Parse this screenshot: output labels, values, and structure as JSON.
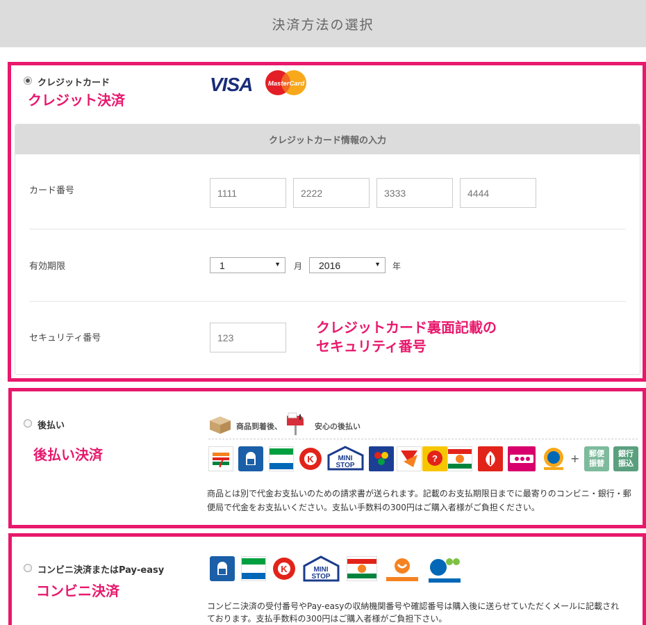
{
  "header": {
    "title": "決済方法の選択"
  },
  "credit": {
    "label": "クレジットカード",
    "annotation": "クレジット決済",
    "brands": {
      "visa": "VISA",
      "mastercard": "MasterCard"
    },
    "panel_title": "クレジットカード情報の入力",
    "card_number_label": "カード番号",
    "card_number_placeholders": [
      "1111",
      "2222",
      "3333",
      "4444"
    ],
    "expiry_label": "有効期限",
    "expiry_month": "1",
    "month_unit": "月",
    "expiry_year": "2016",
    "year_unit": "年",
    "security_label": "セキュリティ番号",
    "security_placeholder": "123",
    "security_annotation_line1": "クレジットカード裏面記載の",
    "security_annotation_line2": "セキュリティ番号"
  },
  "deferred": {
    "label": "後払い",
    "annotation": "後払い決済",
    "step1": "商品到着後、",
    "step2": "安心の後払い",
    "plus": "+",
    "bank1": "郵便\n振替",
    "bank2": "銀行\n振込",
    "description_line1": "商品とは別で代金お支払いのための請求書が送られます。記載のお支払期限日までに最寄りのコンビニ・銀行・郵",
    "description_line2": "便局で代金をお支払いください。支払い手数料の300円はご購入者様がご負担ください。"
  },
  "convenience": {
    "label": "コンビニ決済またはPay-easy",
    "annotation": "コンビニ決済",
    "description_line1": "コンビニ決済の受付番号やPay-easyの収納機関番号や確認番号は購入後に送らせていただくメールに記載され",
    "description_line2": "ております。支払手数料の300円はご購入者様がご負担下さい。"
  },
  "colors": {
    "accent": "#e8186c",
    "header_bg": "#dcdcdc"
  }
}
